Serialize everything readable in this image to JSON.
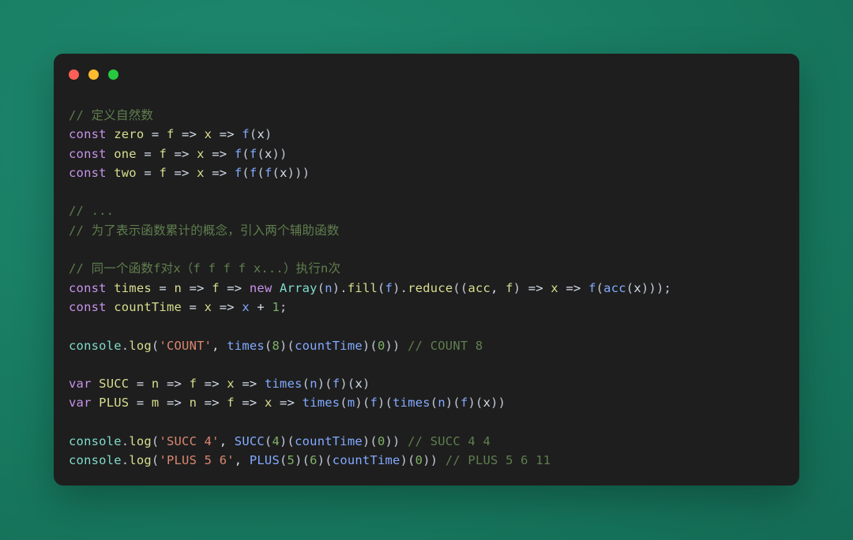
{
  "window": {
    "title": "",
    "traffic_lights": [
      {
        "name": "close",
        "color": "#ff5f56"
      },
      {
        "name": "minimize",
        "color": "#febc2e"
      },
      {
        "name": "maximize",
        "color": "#28c840"
      }
    ],
    "background_color": "#1e1e1e"
  },
  "canvas": {
    "background_color": "#17795f"
  },
  "code": {
    "language": "javascript",
    "lines": [
      {
        "id": "l1",
        "text": "// 定义自然数"
      },
      {
        "id": "l2",
        "text": "const zero = f => x => f(x)"
      },
      {
        "id": "l3",
        "text": "const one = f => x => f(f(x))"
      },
      {
        "id": "l4",
        "text": "const two = f => x => f(f(f(x)))"
      },
      {
        "id": "l5",
        "text": ""
      },
      {
        "id": "l6",
        "text": "// ..."
      },
      {
        "id": "l7",
        "text": "// 为了表示函数累计的概念，引入两个辅助函数"
      },
      {
        "id": "l8",
        "text": ""
      },
      {
        "id": "l9",
        "text": "// 同一个函数f对x（f f f f x...）执行n次"
      },
      {
        "id": "l10",
        "text": "const times = n => f => new Array(n).fill(f).reduce((acc, f) => x => f(acc(x)));"
      },
      {
        "id": "l11",
        "text": "const countTime = x => x + 1;"
      },
      {
        "id": "l12",
        "text": ""
      },
      {
        "id": "l13",
        "text": "console.log('COUNT', times(8)(countTime)(0)) // COUNT 8"
      },
      {
        "id": "l14",
        "text": ""
      },
      {
        "id": "l15",
        "text": "var SUCC = n => f => x => times(n)(f)(x)"
      },
      {
        "id": "l16",
        "text": "var PLUS = m => n => f => x => times(m)(f)(times(n)(f)(x))"
      },
      {
        "id": "l17",
        "text": ""
      },
      {
        "id": "l18",
        "text": "console.log('SUCC 4', SUCC(4)(countTime)(0)) // SUCC 4 4"
      },
      {
        "id": "l19",
        "text": "console.log('PLUS 5 6', PLUS(5)(6)(countTime)(0)) // PLUS 5 6 11"
      }
    ],
    "tokens": {
      "l1": [
        {
          "c": "t-comment",
          "t": "// 定义自然数"
        }
      ],
      "l2": [
        {
          "c": "t-keyword",
          "t": "const"
        },
        {
          "c": "t-plain",
          "t": " "
        },
        {
          "c": "t-def",
          "t": "zero"
        },
        {
          "c": "t-plain",
          "t": " = "
        },
        {
          "c": "t-def",
          "t": "f"
        },
        {
          "c": "t-plain",
          "t": " => "
        },
        {
          "c": "t-def",
          "t": "x"
        },
        {
          "c": "t-plain",
          "t": " => "
        },
        {
          "c": "t-func",
          "t": "f"
        },
        {
          "c": "t-punct",
          "t": "("
        },
        {
          "c": "t-plain",
          "t": "x"
        },
        {
          "c": "t-punct",
          "t": ")"
        }
      ],
      "l3": [
        {
          "c": "t-keyword",
          "t": "const"
        },
        {
          "c": "t-plain",
          "t": " "
        },
        {
          "c": "t-def",
          "t": "one"
        },
        {
          "c": "t-plain",
          "t": " = "
        },
        {
          "c": "t-def",
          "t": "f"
        },
        {
          "c": "t-plain",
          "t": " => "
        },
        {
          "c": "t-def",
          "t": "x"
        },
        {
          "c": "t-plain",
          "t": " => "
        },
        {
          "c": "t-func",
          "t": "f"
        },
        {
          "c": "t-punct",
          "t": "("
        },
        {
          "c": "t-func",
          "t": "f"
        },
        {
          "c": "t-punct",
          "t": "("
        },
        {
          "c": "t-plain",
          "t": "x"
        },
        {
          "c": "t-punct",
          "t": "))"
        }
      ],
      "l4": [
        {
          "c": "t-keyword",
          "t": "const"
        },
        {
          "c": "t-plain",
          "t": " "
        },
        {
          "c": "t-def",
          "t": "two"
        },
        {
          "c": "t-plain",
          "t": " = "
        },
        {
          "c": "t-def",
          "t": "f"
        },
        {
          "c": "t-plain",
          "t": " => "
        },
        {
          "c": "t-def",
          "t": "x"
        },
        {
          "c": "t-plain",
          "t": " => "
        },
        {
          "c": "t-func",
          "t": "f"
        },
        {
          "c": "t-punct",
          "t": "("
        },
        {
          "c": "t-func",
          "t": "f"
        },
        {
          "c": "t-punct",
          "t": "("
        },
        {
          "c": "t-func",
          "t": "f"
        },
        {
          "c": "t-punct",
          "t": "("
        },
        {
          "c": "t-plain",
          "t": "x"
        },
        {
          "c": "t-punct",
          "t": ")))"
        }
      ],
      "l5": [],
      "l6": [
        {
          "c": "t-comment",
          "t": "// ..."
        }
      ],
      "l7": [
        {
          "c": "t-comment",
          "t": "// 为了表示函数累计的概念，引入两个辅助函数"
        }
      ],
      "l8": [],
      "l9": [
        {
          "c": "t-comment",
          "t": "// 同一个函数f对x（f f f f x...）执行n次"
        }
      ],
      "l10": [
        {
          "c": "t-keyword",
          "t": "const"
        },
        {
          "c": "t-plain",
          "t": " "
        },
        {
          "c": "t-def",
          "t": "times"
        },
        {
          "c": "t-plain",
          "t": " = "
        },
        {
          "c": "t-def",
          "t": "n"
        },
        {
          "c": "t-plain",
          "t": " => "
        },
        {
          "c": "t-def",
          "t": "f"
        },
        {
          "c": "t-plain",
          "t": " => "
        },
        {
          "c": "t-keyword",
          "t": "new"
        },
        {
          "c": "t-plain",
          "t": " "
        },
        {
          "c": "t-class",
          "t": "Array"
        },
        {
          "c": "t-punct",
          "t": "("
        },
        {
          "c": "t-func",
          "t": "n"
        },
        {
          "c": "t-punct",
          "t": ")."
        },
        {
          "c": "t-prop",
          "t": "fill"
        },
        {
          "c": "t-punct",
          "t": "("
        },
        {
          "c": "t-func",
          "t": "f"
        },
        {
          "c": "t-punct",
          "t": ")."
        },
        {
          "c": "t-prop",
          "t": "reduce"
        },
        {
          "c": "t-punct",
          "t": "(("
        },
        {
          "c": "t-def",
          "t": "acc"
        },
        {
          "c": "t-plain",
          "t": ", "
        },
        {
          "c": "t-def",
          "t": "f"
        },
        {
          "c": "t-punct",
          "t": ")"
        },
        {
          "c": "t-plain",
          "t": " => "
        },
        {
          "c": "t-def",
          "t": "x"
        },
        {
          "c": "t-plain",
          "t": " => "
        },
        {
          "c": "t-func",
          "t": "f"
        },
        {
          "c": "t-punct",
          "t": "("
        },
        {
          "c": "t-func",
          "t": "acc"
        },
        {
          "c": "t-punct",
          "t": "("
        },
        {
          "c": "t-plain",
          "t": "x"
        },
        {
          "c": "t-punct",
          "t": ")));"
        }
      ],
      "l11": [
        {
          "c": "t-keyword",
          "t": "const"
        },
        {
          "c": "t-plain",
          "t": " "
        },
        {
          "c": "t-def",
          "t": "countTime"
        },
        {
          "c": "t-plain",
          "t": " = "
        },
        {
          "c": "t-def",
          "t": "x"
        },
        {
          "c": "t-plain",
          "t": " => "
        },
        {
          "c": "t-func",
          "t": "x"
        },
        {
          "c": "t-plain",
          "t": " + "
        },
        {
          "c": "t-number",
          "t": "1"
        },
        {
          "c": "t-punct",
          "t": ";"
        }
      ],
      "l12": [],
      "l13": [
        {
          "c": "t-obj",
          "t": "console"
        },
        {
          "c": "t-punct",
          "t": "."
        },
        {
          "c": "t-prop",
          "t": "log"
        },
        {
          "c": "t-punct",
          "t": "("
        },
        {
          "c": "t-string",
          "t": "'COUNT'"
        },
        {
          "c": "t-plain",
          "t": ", "
        },
        {
          "c": "t-func",
          "t": "times"
        },
        {
          "c": "t-punct",
          "t": "("
        },
        {
          "c": "t-number",
          "t": "8"
        },
        {
          "c": "t-punct",
          "t": ")("
        },
        {
          "c": "t-func",
          "t": "countTime"
        },
        {
          "c": "t-punct",
          "t": ")("
        },
        {
          "c": "t-number",
          "t": "0"
        },
        {
          "c": "t-punct",
          "t": "))"
        },
        {
          "c": "t-plain",
          "t": " "
        },
        {
          "c": "t-comment",
          "t": "// COUNT 8"
        }
      ],
      "l14": [],
      "l15": [
        {
          "c": "t-keyword",
          "t": "var"
        },
        {
          "c": "t-plain",
          "t": " "
        },
        {
          "c": "t-def",
          "t": "SUCC"
        },
        {
          "c": "t-plain",
          "t": " = "
        },
        {
          "c": "t-def",
          "t": "n"
        },
        {
          "c": "t-plain",
          "t": " => "
        },
        {
          "c": "t-def",
          "t": "f"
        },
        {
          "c": "t-plain",
          "t": " => "
        },
        {
          "c": "t-def",
          "t": "x"
        },
        {
          "c": "t-plain",
          "t": " => "
        },
        {
          "c": "t-func",
          "t": "times"
        },
        {
          "c": "t-punct",
          "t": "("
        },
        {
          "c": "t-func",
          "t": "n"
        },
        {
          "c": "t-punct",
          "t": ")("
        },
        {
          "c": "t-func",
          "t": "f"
        },
        {
          "c": "t-punct",
          "t": ")("
        },
        {
          "c": "t-plain",
          "t": "x"
        },
        {
          "c": "t-punct",
          "t": ")"
        }
      ],
      "l16": [
        {
          "c": "t-keyword",
          "t": "var"
        },
        {
          "c": "t-plain",
          "t": " "
        },
        {
          "c": "t-def",
          "t": "PLUS"
        },
        {
          "c": "t-plain",
          "t": " = "
        },
        {
          "c": "t-def",
          "t": "m"
        },
        {
          "c": "t-plain",
          "t": " => "
        },
        {
          "c": "t-def",
          "t": "n"
        },
        {
          "c": "t-plain",
          "t": " => "
        },
        {
          "c": "t-def",
          "t": "f"
        },
        {
          "c": "t-plain",
          "t": " => "
        },
        {
          "c": "t-def",
          "t": "x"
        },
        {
          "c": "t-plain",
          "t": " => "
        },
        {
          "c": "t-func",
          "t": "times"
        },
        {
          "c": "t-punct",
          "t": "("
        },
        {
          "c": "t-func",
          "t": "m"
        },
        {
          "c": "t-punct",
          "t": ")("
        },
        {
          "c": "t-func",
          "t": "f"
        },
        {
          "c": "t-punct",
          "t": ")("
        },
        {
          "c": "t-func",
          "t": "times"
        },
        {
          "c": "t-punct",
          "t": "("
        },
        {
          "c": "t-func",
          "t": "n"
        },
        {
          "c": "t-punct",
          "t": ")("
        },
        {
          "c": "t-func",
          "t": "f"
        },
        {
          "c": "t-punct",
          "t": ")("
        },
        {
          "c": "t-plain",
          "t": "x"
        },
        {
          "c": "t-punct",
          "t": "))"
        }
      ],
      "l17": [],
      "l18": [
        {
          "c": "t-obj",
          "t": "console"
        },
        {
          "c": "t-punct",
          "t": "."
        },
        {
          "c": "t-prop",
          "t": "log"
        },
        {
          "c": "t-punct",
          "t": "("
        },
        {
          "c": "t-string",
          "t": "'SUCC 4'"
        },
        {
          "c": "t-plain",
          "t": ", "
        },
        {
          "c": "t-func",
          "t": "SUCC"
        },
        {
          "c": "t-punct",
          "t": "("
        },
        {
          "c": "t-number",
          "t": "4"
        },
        {
          "c": "t-punct",
          "t": ")("
        },
        {
          "c": "t-func",
          "t": "countTime"
        },
        {
          "c": "t-punct",
          "t": ")("
        },
        {
          "c": "t-number",
          "t": "0"
        },
        {
          "c": "t-punct",
          "t": "))"
        },
        {
          "c": "t-plain",
          "t": " "
        },
        {
          "c": "t-comment",
          "t": "// SUCC 4 4"
        }
      ],
      "l19": [
        {
          "c": "t-obj",
          "t": "console"
        },
        {
          "c": "t-punct",
          "t": "."
        },
        {
          "c": "t-prop",
          "t": "log"
        },
        {
          "c": "t-punct",
          "t": "("
        },
        {
          "c": "t-string",
          "t": "'PLUS 5 6'"
        },
        {
          "c": "t-plain",
          "t": ", "
        },
        {
          "c": "t-func",
          "t": "PLUS"
        },
        {
          "c": "t-punct",
          "t": "("
        },
        {
          "c": "t-number",
          "t": "5"
        },
        {
          "c": "t-punct",
          "t": ")("
        },
        {
          "c": "t-number",
          "t": "6"
        },
        {
          "c": "t-punct",
          "t": ")("
        },
        {
          "c": "t-func",
          "t": "countTime"
        },
        {
          "c": "t-punct",
          "t": ")("
        },
        {
          "c": "t-number",
          "t": "0"
        },
        {
          "c": "t-punct",
          "t": "))"
        },
        {
          "c": "t-plain",
          "t": " "
        },
        {
          "c": "t-comment",
          "t": "// PLUS 5 6 11"
        }
      ]
    }
  }
}
